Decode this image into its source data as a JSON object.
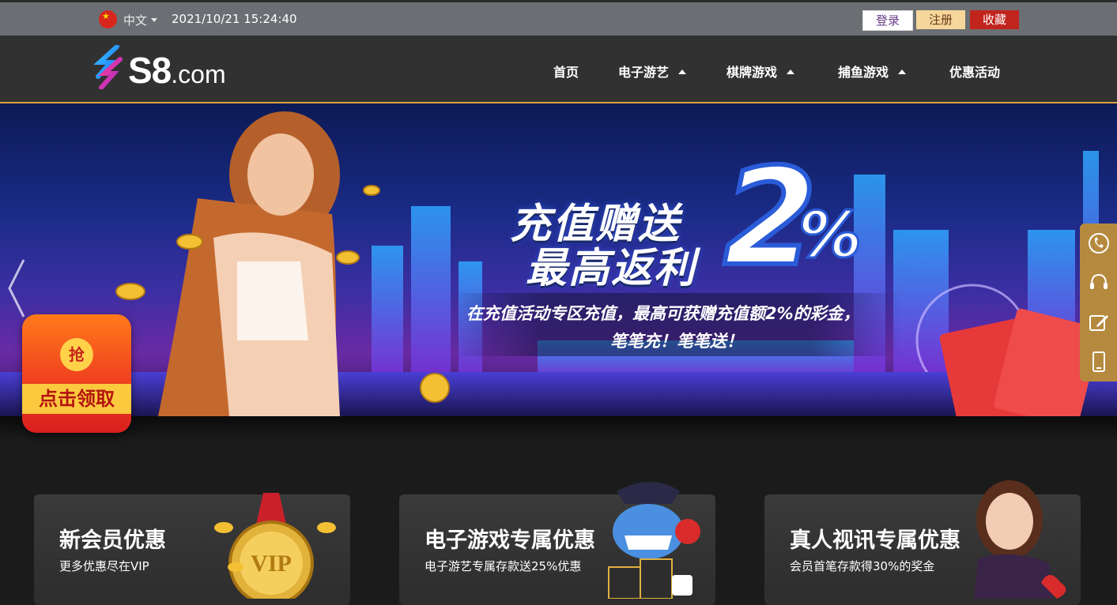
{
  "topbar": {
    "language": "中文",
    "datetime": "2021/10/21 15:24:40",
    "login_label": "登录",
    "register_label": "注册",
    "favorite_label": "收藏"
  },
  "header": {
    "logo_text": "S8",
    "logo_suffix": ".com",
    "nav": [
      {
        "label": "首页",
        "has_dropdown": false
      },
      {
        "label": "电子游艺",
        "has_dropdown": true
      },
      {
        "label": "棋牌游戏",
        "has_dropdown": true
      },
      {
        "label": "捕鱼游戏",
        "has_dropdown": true
      },
      {
        "label": "优惠活动",
        "has_dropdown": false
      }
    ]
  },
  "banner": {
    "line1": "充值赠送",
    "line2": "最高返利",
    "big_number": "2",
    "percent": "%",
    "desc_line1": "在充值活动专区充值，最高可获赠充值额2%的彩金，",
    "desc_line2": "笔笔充！笔笔送！"
  },
  "grab_widget": {
    "coin_text": "抢",
    "label": "点击领取"
  },
  "side_tools": [
    {
      "icon": "phone-icon"
    },
    {
      "icon": "headset-icon"
    },
    {
      "icon": "edit-icon"
    },
    {
      "icon": "mobile-icon"
    }
  ],
  "cards": [
    {
      "title": "新会员优惠",
      "subtitle": "更多优惠尽在VIP",
      "art_text": "VIP"
    },
    {
      "title": "电子游戏专属优惠",
      "subtitle": "电子游艺专属存款送25%优惠"
    },
    {
      "title": "真人视讯专属优惠",
      "subtitle": "会员首笔存款得30%的奖金"
    }
  ],
  "colors": {
    "topbar_bg": "#6b6f73",
    "header_bg": "#313131",
    "accent_gold": "#d9a53f",
    "favorite_red": "#c1241d",
    "register_tan": "#f6d69b",
    "page_bg": "#1b1b1b"
  }
}
